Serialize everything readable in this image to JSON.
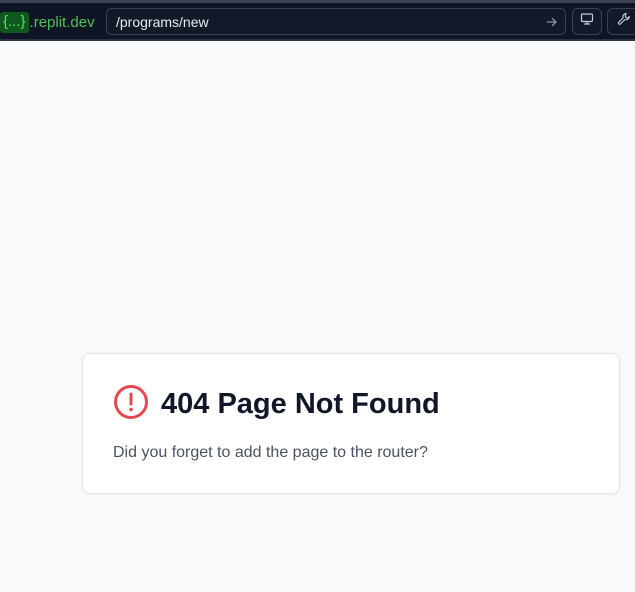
{
  "toolbar": {
    "domain_token": "{...}",
    "domain_suffix": ".replit.dev",
    "url_path": "/programs/new",
    "icons": {
      "go": "arrow-right-icon",
      "devices": "monitor-icon",
      "tools": "wrench-icon"
    }
  },
  "error_card": {
    "title": "404 Page Not Found",
    "message": "Did you forget to add the page to the router?",
    "icon": "alert-circle-icon",
    "icon_color": "#e5484d"
  },
  "colors": {
    "toolbar_bg": "#0f1524",
    "domain_green": "#4ec25e",
    "page_bg": "#f8f9fb",
    "title_color": "#101729",
    "text_color": "#4a5263"
  }
}
